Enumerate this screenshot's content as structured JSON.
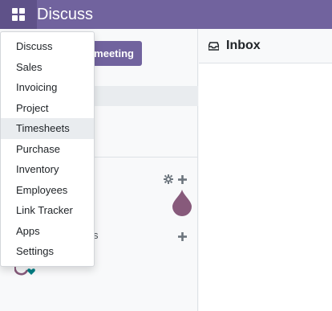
{
  "navbar": {
    "brand": "Discuss",
    "apps_icon": "grid-icon"
  },
  "sidebar": {
    "start_meeting_label": "meeting",
    "channel_tail": "s"
  },
  "main": {
    "header_title": "Inbox",
    "header_icon": "inbox-icon"
  },
  "apps_menu": {
    "items": [
      {
        "label": "Discuss"
      },
      {
        "label": "Sales"
      },
      {
        "label": "Invoicing"
      },
      {
        "label": "Project"
      },
      {
        "label": "Timesheets"
      },
      {
        "label": "Purchase"
      },
      {
        "label": "Inventory"
      },
      {
        "label": "Employees"
      },
      {
        "label": "Link Tracker"
      },
      {
        "label": "Apps"
      },
      {
        "label": "Settings"
      }
    ]
  },
  "colors": {
    "brand": "#71639e",
    "avatar": "#875a7b",
    "status_online": "#017e84"
  }
}
